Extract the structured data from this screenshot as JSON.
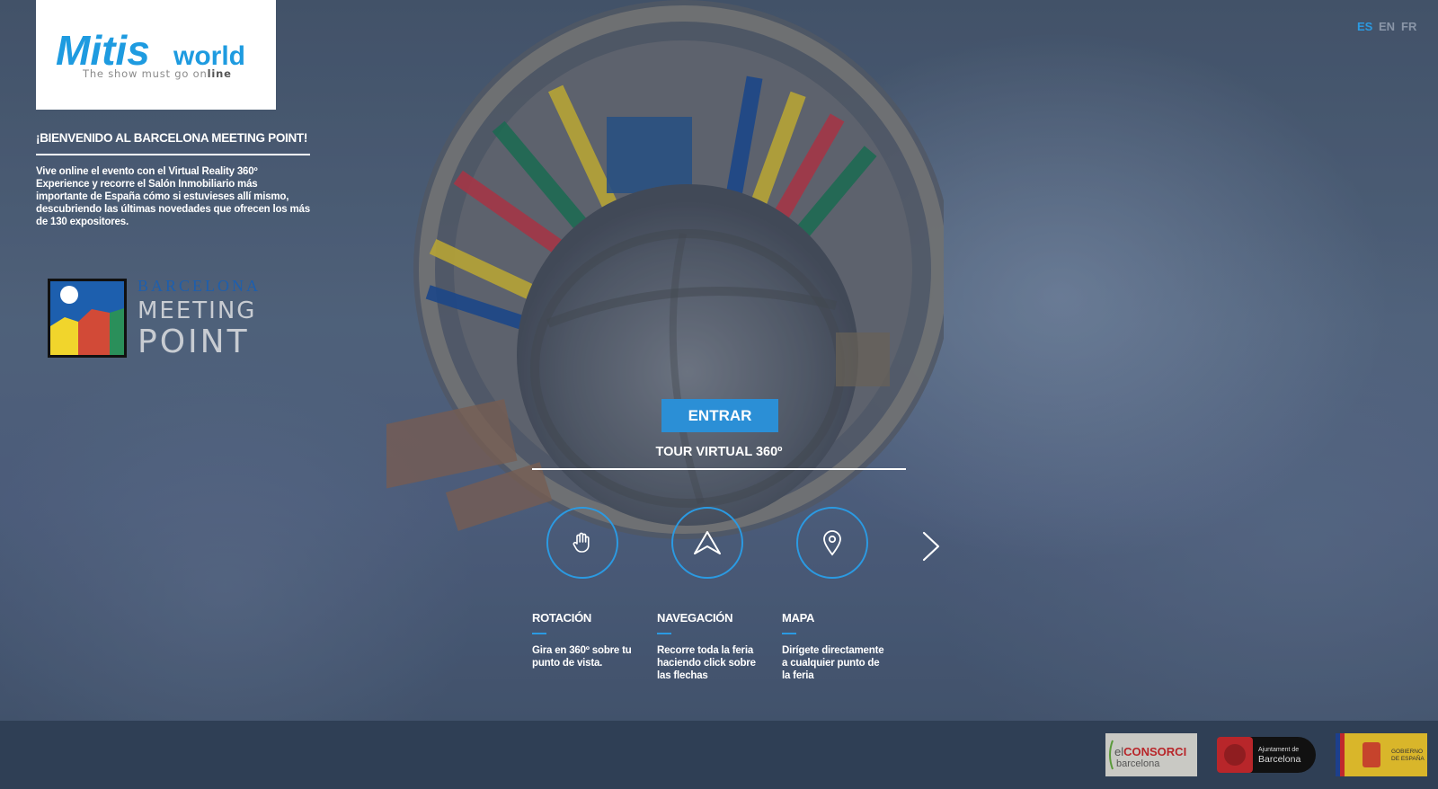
{
  "brand": {
    "logo_name": "Mitisworld",
    "logo_text_mitis": "Mitis",
    "logo_text_world": "world",
    "tagline_pre": "The show must go on",
    "tagline_bold": "line"
  },
  "languages": [
    {
      "code": "ES",
      "active": true
    },
    {
      "code": "EN",
      "active": false
    },
    {
      "code": "FR",
      "active": false
    }
  ],
  "welcome": {
    "title": "¡BIENVENIDO AL BARCELONA MEETING POINT!",
    "text": "Vive online el evento con el Virtual Reality 360º Experience y recorre el Salón Inmobiliario más importante de España cómo si estuvieses allí mismo, descubriendo las últimas novedades que ofrecen los más de 130 expositores."
  },
  "event_logo": {
    "line1": "BARCELONA",
    "line2": "MEETING",
    "line3": "POINT"
  },
  "cta": {
    "enter_label": "ENTRAR",
    "tour_title": "TOUR VIRTUAL 360º"
  },
  "features": [
    {
      "title": "ROTACIÓN",
      "description": "Gira en 360º sobre tu punto de vista.",
      "icon": "hand-icon"
    },
    {
      "title": "NAVEGACIÓN",
      "description": "Recorre toda la feria haciendo click sobre las flechas",
      "icon": "navigation-arrow-icon"
    },
    {
      "title": "MAPA",
      "description": "Dirígete directamente a cualquier punto de la feria",
      "icon": "map-pin-icon"
    }
  ],
  "sponsors": [
    {
      "name": "elConsorci barcelona",
      "text_a": "el",
      "text_b": "CONSORCI",
      "text_c": "barcelona"
    },
    {
      "name": "Ajuntament de Barcelona",
      "text_a": "Ajuntament de",
      "text_b": "Barcelona"
    },
    {
      "name": "Gobierno de España",
      "text_a": "GOBIERNO",
      "text_b": "DE ESPAÑA"
    }
  ],
  "colors": {
    "accent": "#2b9ae2",
    "button": "#2b8fd6",
    "footer": "#2f3f55",
    "brand_blue": "#1e9be0"
  }
}
